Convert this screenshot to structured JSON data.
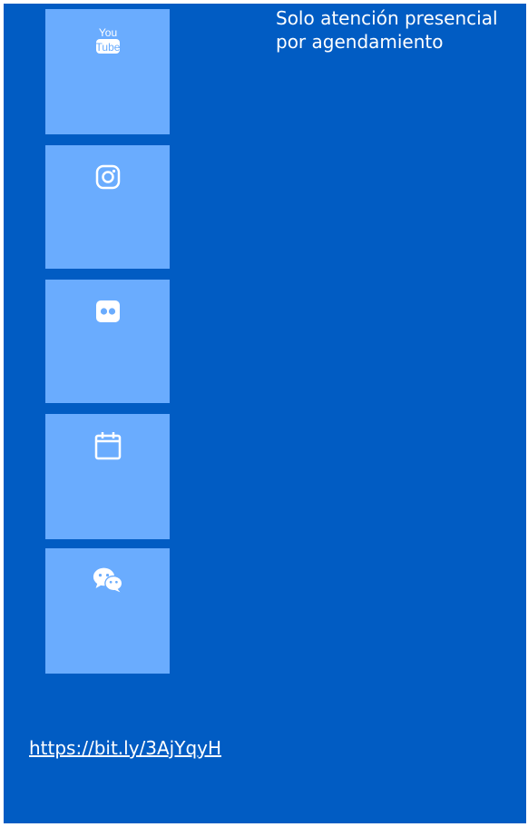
{
  "colors": {
    "panel_background": "#015cc3",
    "tile_background": "#6aacfe",
    "text": "#ffffff"
  },
  "social_tiles": [
    {
      "icon": "youtube-icon",
      "icon_text_top": "You",
      "icon_text_bottom": "Tube"
    },
    {
      "icon": "instagram-icon"
    },
    {
      "icon": "flickr-icon"
    },
    {
      "icon": "calendar-icon"
    },
    {
      "icon": "wechat-icon"
    }
  ],
  "notice": {
    "text": "Solo atención presencial por agendamiento"
  },
  "footer": {
    "link_text": "https://bit.ly/3AjYqyH"
  }
}
